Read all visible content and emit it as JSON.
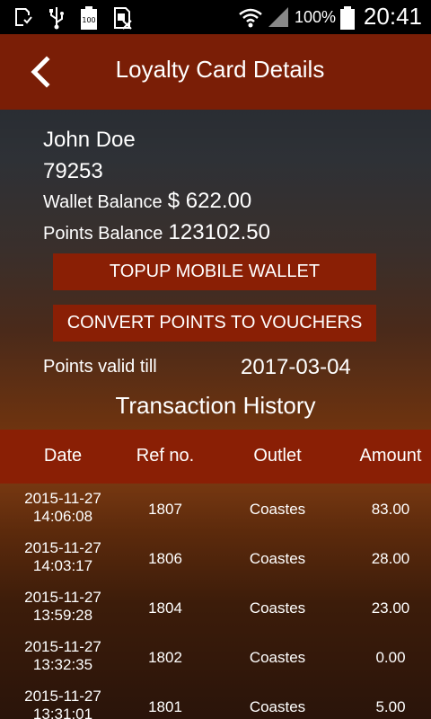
{
  "status_bar": {
    "battery_percent": "100%",
    "time": "20:41",
    "icons": [
      "sd-card-icon",
      "usb-icon",
      "battery-100-icon",
      "no-sim-icon",
      "wifi-icon",
      "signal-icon",
      "battery-icon"
    ]
  },
  "header": {
    "title": "Loyalty Card Details",
    "back_icon": "chevron-left-icon"
  },
  "card": {
    "name": "John Doe",
    "card_number": "79253",
    "wallet_label": "Wallet Balance",
    "wallet_value": "$ 622.00",
    "points_label": "Points Balance",
    "points_value": "123102.50",
    "valid_label": "Points valid till",
    "valid_value": "2017-03-04"
  },
  "buttons": {
    "topup": "TOPUP MOBILE WALLET",
    "convert": "CONVERT POINTS TO VOUCHERS"
  },
  "transactions": {
    "title": "Transaction History",
    "columns": [
      "Date",
      "Ref no.",
      "Outlet",
      "Amount"
    ],
    "rows": [
      {
        "date": "2015-11-27",
        "time": "14:06:08",
        "ref": "1807",
        "outlet": "Coastes",
        "amount": "83.00"
      },
      {
        "date": "2015-11-27",
        "time": "14:03:17",
        "ref": "1806",
        "outlet": "Coastes",
        "amount": "28.00"
      },
      {
        "date": "2015-11-27",
        "time": "13:59:28",
        "ref": "1804",
        "outlet": "Coastes",
        "amount": "23.00"
      },
      {
        "date": "2015-11-27",
        "time": "13:32:35",
        "ref": "1802",
        "outlet": "Coastes",
        "amount": "0.00"
      },
      {
        "date": "2015-11-27",
        "time": "13:31:01",
        "ref": "1801",
        "outlet": "Coastes",
        "amount": "5.00"
      }
    ]
  },
  "colors": {
    "header_bg": "#7a1e06",
    "button_bg": "#8a1f05",
    "statusbar_bg": "#000000"
  }
}
